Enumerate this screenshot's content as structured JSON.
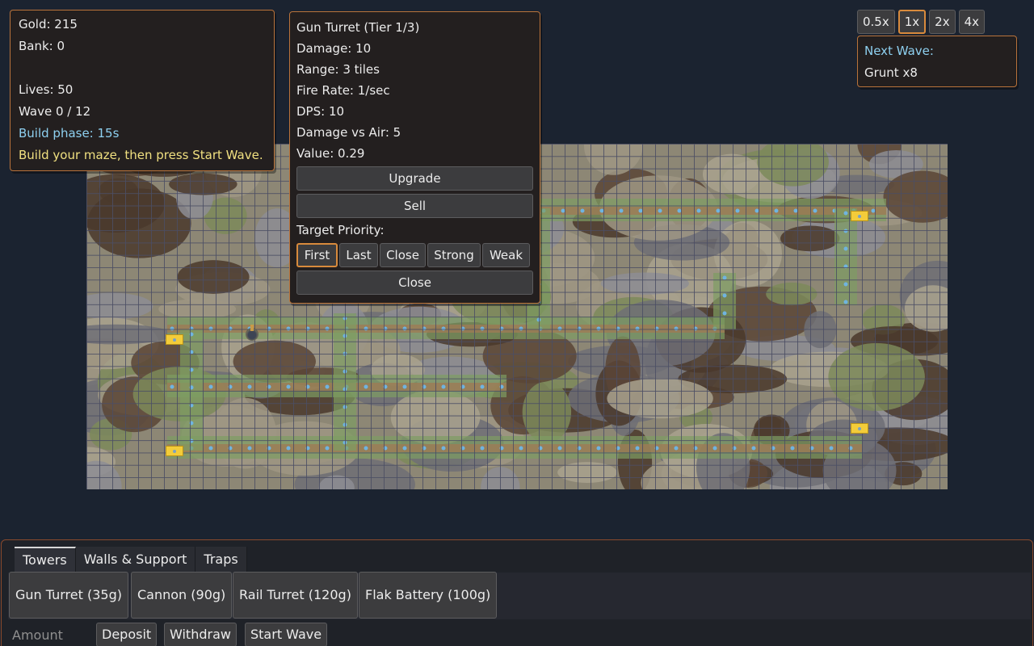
{
  "stats": {
    "gold": "Gold: 215",
    "bank": "Bank: 0",
    "lives": "Lives: 50",
    "wave": "Wave 0 / 12",
    "phase": "Build phase: 15s",
    "hint": "Build your maze, then press Start Wave."
  },
  "tower_info": {
    "title": "Gun Turret (Tier 1/3)",
    "damage": "Damage: 10",
    "range": "Range: 3 tiles",
    "fire_rate": "Fire Rate: 1/sec",
    "dps": "DPS: 10",
    "damage_air": "Damage vs Air: 5",
    "value": "Value: 0.29",
    "upgrade_label": "Upgrade",
    "sell_label": "Sell",
    "priority_label": "Target Priority:",
    "priorities": [
      "First",
      "Last",
      "Close",
      "Strong",
      "Weak"
    ],
    "selected_priority": "First",
    "close_label": "Close"
  },
  "speed": {
    "options": [
      "0.5x",
      "1x",
      "2x",
      "4x"
    ],
    "selected": "1x"
  },
  "next_wave": {
    "label": "Next Wave:",
    "enemies": "Grunt x8"
  },
  "build": {
    "tabs": [
      "Towers",
      "Walls & Support",
      "Traps"
    ],
    "active_tab": "Towers",
    "towers": [
      "Gun Turret (35g)",
      "Cannon (90g)",
      "Rail Turret (120g)",
      "Flak Battery (100g)"
    ],
    "amount_placeholder": "Amount",
    "deposit_label": "Deposit",
    "withdraw_label": "Withdraw",
    "start_wave_label": "Start Wave"
  },
  "colors": {
    "panel_border": "#b9733b",
    "accent_blue": "#8ed0f0",
    "accent_yellow": "#f0e080",
    "goal_marker": "#f3cc3a"
  }
}
